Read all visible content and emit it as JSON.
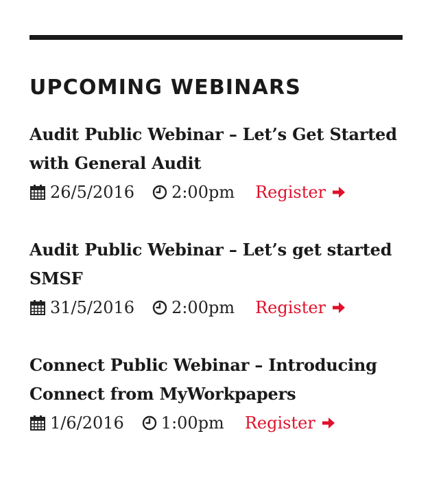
{
  "widget": {
    "title": "UPCOMING WEBINARS",
    "accent_color": "#e0102b",
    "rule_color": "#1a1a1a"
  },
  "events": [
    {
      "title": "Audit Public Webinar – Let’s Get Started with General Audit",
      "date": "26/5/2016",
      "time": "2:00pm",
      "register_label": "Register"
    },
    {
      "title": "Audit Public Webinar – Let’s get started SMSF",
      "date": "31/5/2016",
      "time": "2:00pm",
      "register_label": "Register"
    },
    {
      "title": "Connect Public Webinar – Introducing Connect from MyWorkpapers",
      "date": "1/6/2016",
      "time": "1:00pm",
      "register_label": "Register"
    }
  ],
  "icons": {
    "date": "calendar-icon",
    "time": "clock-icon",
    "register": "arrow-right-icon"
  }
}
